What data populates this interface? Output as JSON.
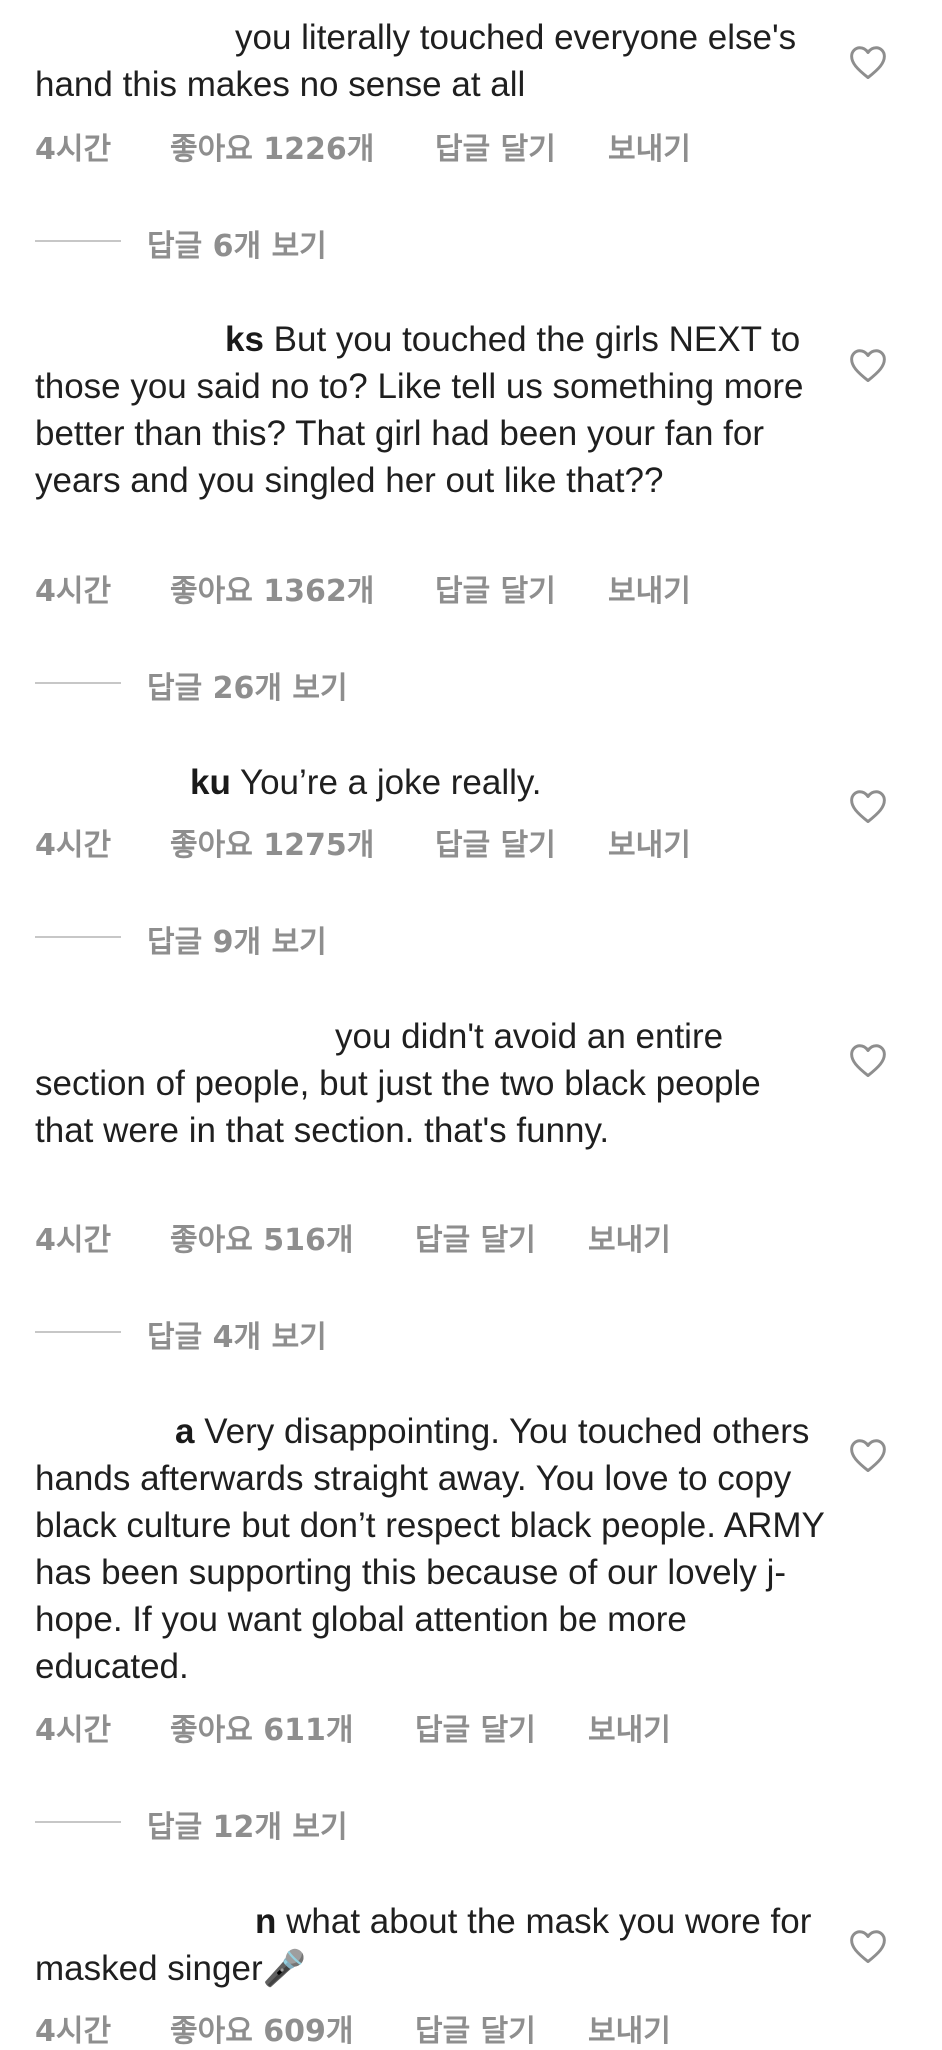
{
  "comments": [
    {
      "username": "",
      "text": "you  literally touched everyone else's hand this makes no sense at all",
      "time": "4시간",
      "likes": "좋아요 1226개",
      "reply": "답글 달기",
      "send": "보내기",
      "view_replies": "답글 6개 보기"
    },
    {
      "username": "ks",
      "text": "But you touched the girls NEXT to those you said no to? Like tell us something more better than this? That girl had been your fan for years and you singled her out like that??",
      "time": "4시간",
      "likes": "좋아요 1362개",
      "reply": "답글 달기",
      "send": "보내기",
      "view_replies": "답글 26개 보기"
    },
    {
      "username": "ku",
      "text": "You’re a joke really.",
      "time": "4시간",
      "likes": "좋아요 1275개",
      "reply": "답글 달기",
      "send": "보내기",
      "view_replies": "답글 9개 보기"
    },
    {
      "username": "",
      "text": "you didn't avoid an entire section of people, but just the two black people that were in that section. that's funny.",
      "time": "4시간",
      "likes": "좋아요 516개",
      "reply": "답글 달기",
      "send": "보내기",
      "view_replies": "답글 4개 보기"
    },
    {
      "username": "a",
      "text": "Very disappointing. You touched others hands afterwards straight away. You love to copy black culture but don’t respect black people. ARMY has been supporting this because of our lovely j-hope. If you want global attention be more educated.",
      "time": "4시간",
      "likes": "좋아요 611개",
      "reply": "답글 달기",
      "send": "보내기",
      "view_replies": "답글 12개 보기"
    },
    {
      "username": "n",
      "text": "what about the mask you wore for masked singer🎤",
      "time": "4시간",
      "likes": "좋아요 609개",
      "reply": "답글 달기",
      "send": "보내기"
    }
  ],
  "icons": {
    "like": "heart-outline-icon"
  },
  "colors": {
    "meta": "#8e8e8e",
    "text": "#1f1f1f",
    "divider": "#c7c7c7"
  }
}
